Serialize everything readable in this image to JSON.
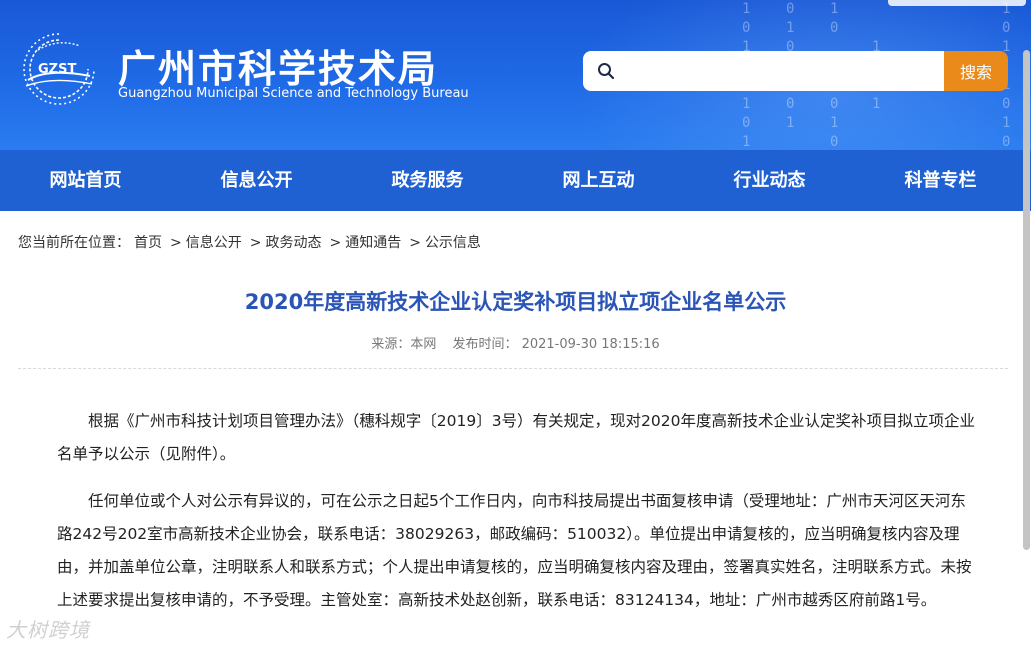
{
  "header": {
    "logo_text": "GZST",
    "title_cn": "广州市科学技术局",
    "title_en": "Guangzhou Municipal Science and Technology Bureau"
  },
  "search": {
    "placeholder": "",
    "button_label": "搜索"
  },
  "nav": {
    "items": [
      {
        "label": "网站首页"
      },
      {
        "label": "信息公开"
      },
      {
        "label": "政务服务"
      },
      {
        "label": "网上互动"
      },
      {
        "label": "行业动态"
      },
      {
        "label": "科普专栏"
      }
    ]
  },
  "breadcrumb": {
    "prefix": "您当前所在位置：",
    "items": [
      "首页",
      "信息公开",
      "政务动态",
      "通知通告",
      "公示信息"
    ],
    "separator": ">"
  },
  "article": {
    "title": "2020年度高新技术企业认定奖补项目拟立项企业名单公示",
    "source": "来源：本网",
    "publish_time": "发布时间： 2021-09-30 18:15:16",
    "paragraphs": [
      "根据《广州市科技计划项目管理办法》（穗科规字〔2019〕3号）有关规定，现对2020年度高新技术企业认定奖补项目拟立项企业名单予以公示（见附件）。",
      "任何单位或个人对公示有异议的，可在公示之日起5个工作日内，向市科技局提出书面复核申请（受理地址：广州市天河区天河东路242号202室市高新技术企业协会，联系电话：38029263，邮政编码：510032）。单位提出申请复核的，应当明确复核内容及理由，并加盖单位公章，注明联系人和联系方式；个人提出申请复核的，应当明确复核内容及理由，签署真实姓名，注明联系方式。未按上述要求提出复核申请的，不予受理。主管处室：高新技术处赵创新，联系电话：83124134，地址：广州市越秀区府前路1号。"
    ]
  },
  "watermark": "大树跨境",
  "colors": {
    "header_blue": "#1f6ae6",
    "nav_blue": "#1f60d3",
    "title_blue": "#2a54b6",
    "search_orange": "#e98a1b"
  }
}
